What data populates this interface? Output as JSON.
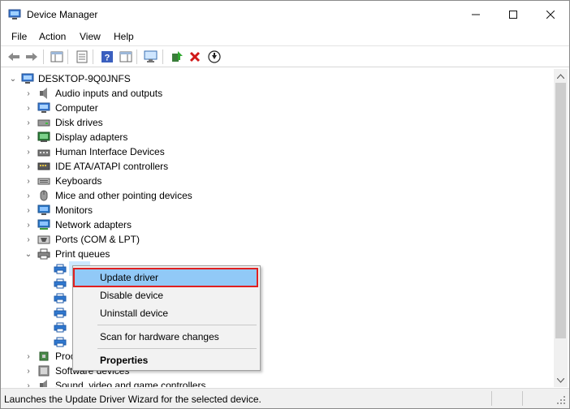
{
  "window": {
    "title": "Device Manager",
    "controls": {
      "minimize": "—",
      "maximize": "☐",
      "close": "✕"
    }
  },
  "menu": [
    "File",
    "Action",
    "View",
    "Help"
  ],
  "toolbar": {
    "icons": [
      "back-icon",
      "forward-icon",
      "show-hide-console-tree-icon",
      "properties-sheet-icon",
      "help-icon",
      "action-pane-icon",
      "scan-hardware-icon",
      "update-driver-icon",
      "uninstall-icon",
      "disable-device-icon"
    ]
  },
  "tree": {
    "root": "DESKTOP-9Q0JNFS",
    "categories": [
      "Audio inputs and outputs",
      "Computer",
      "Disk drives",
      "Display adapters",
      "Human Interface Devices",
      "IDE ATA/ATAPI controllers",
      "Keyboards",
      "Mice and other pointing devices",
      "Monitors",
      "Network adapters",
      "Ports (COM & LPT)",
      "Print queues"
    ],
    "after": [
      "Proc",
      "Software devices",
      "Sound, video and game controllers"
    ]
  },
  "context_menu": {
    "items": [
      "Update driver",
      "Disable device",
      "Uninstall device",
      "Scan for hardware changes",
      "Properties"
    ]
  },
  "status": {
    "text": "Launches the Update Driver Wizard for the selected device."
  },
  "colors": {
    "highlight": "#91c9f7",
    "highlight_border": "#e02020",
    "selection": "#cde8ff"
  }
}
